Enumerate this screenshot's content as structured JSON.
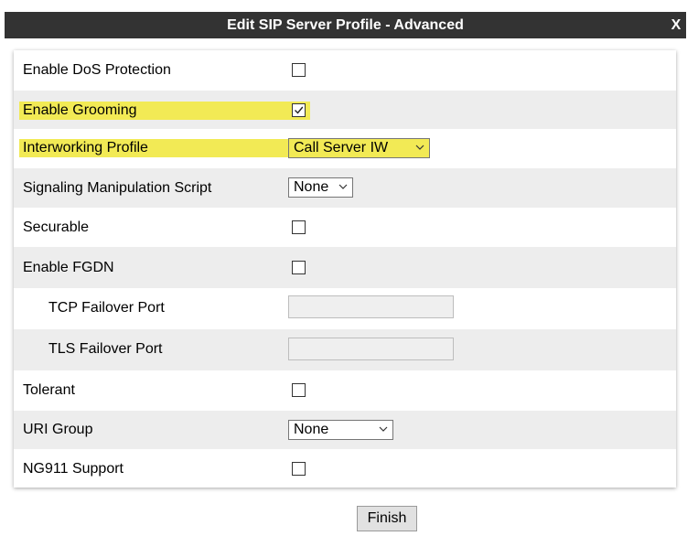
{
  "dialog": {
    "title": "Edit SIP Server Profile - Advanced",
    "close_label": "X"
  },
  "fields": {
    "enable_dos_protection": {
      "label": "Enable DoS Protection",
      "checked": false
    },
    "enable_grooming": {
      "label": "Enable Grooming",
      "checked": true
    },
    "interworking_profile": {
      "label": "Interworking Profile",
      "value": "Call Server IW"
    },
    "signaling_manipulation_script": {
      "label": "Signaling Manipulation Script",
      "value": "None"
    },
    "securable": {
      "label": "Securable",
      "checked": false
    },
    "enable_fgdn": {
      "label": "Enable FGDN",
      "checked": false
    },
    "tcp_failover_port": {
      "label": "TCP Failover Port",
      "value": ""
    },
    "tls_failover_port": {
      "label": "TLS Failover Port",
      "value": ""
    },
    "tolerant": {
      "label": "Tolerant",
      "checked": false
    },
    "uri_group": {
      "label": "URI Group",
      "value": "None"
    },
    "ng911_support": {
      "label": "NG911 Support",
      "checked": false
    }
  },
  "buttons": {
    "finish_label": "Finish"
  },
  "colors": {
    "highlight": "#f2ea55",
    "titlebar": "#333333",
    "alt_row": "#ededed"
  }
}
